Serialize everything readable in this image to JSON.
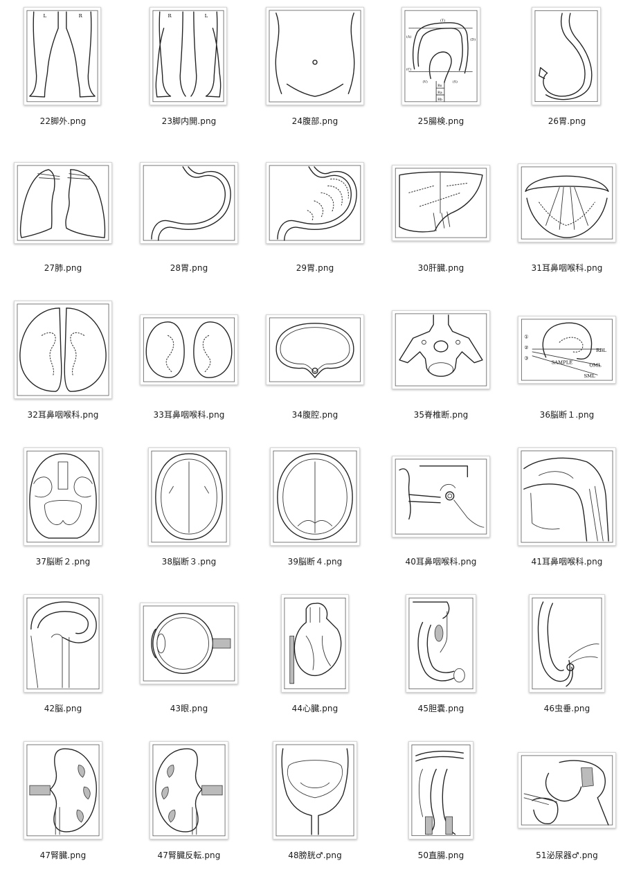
{
  "files": [
    {
      "name": "22脚外.png",
      "icon": "legs-front-icon",
      "art": "legs",
      "labels": [
        "L",
        "R"
      ]
    },
    {
      "name": "23脚内開.png",
      "icon": "legs-inner-icon",
      "art": "legs",
      "labels": [
        "R",
        "L"
      ]
    },
    {
      "name": "24腹部.png",
      "icon": "abdomen-icon",
      "art": "abdomen"
    },
    {
      "name": "25腸検.png",
      "icon": "colon-exam-icon",
      "art": "colon",
      "labels": [
        "(T)",
        "(A)",
        "(D)",
        "(C)",
        "(V)",
        "(S)",
        "Rs",
        "Ra",
        "Rb"
      ]
    },
    {
      "name": "26胃.png",
      "icon": "stomach-icon",
      "art": "stomach-simple"
    },
    {
      "name": "27肺.png",
      "icon": "lungs-icon",
      "art": "lungs"
    },
    {
      "name": "28胃.png",
      "icon": "stomach-icon",
      "art": "stomach"
    },
    {
      "name": "29胃.png",
      "icon": "stomach-mucosa-icon",
      "art": "stomach-mucosa"
    },
    {
      "name": "30肝臓.png",
      "icon": "liver-icon",
      "art": "liver"
    },
    {
      "name": "31耳鼻咽喉科.png",
      "icon": "larynx-icon",
      "art": "larynx"
    },
    {
      "name": "32耳鼻咽喉科.png",
      "icon": "tonsils-icon",
      "art": "tonsils-large"
    },
    {
      "name": "33耳鼻咽喉科.png",
      "icon": "tonsils-icon",
      "art": "tonsils-small"
    },
    {
      "name": "34腹腔.png",
      "icon": "abdominal-cavity-icon",
      "art": "cavity"
    },
    {
      "name": "35脊椎断.png",
      "icon": "vertebra-icon",
      "art": "vertebra"
    },
    {
      "name": "36脳断１.png",
      "icon": "brain-section-icon",
      "art": "sample",
      "labels": [
        "①",
        "②",
        "③",
        "RBL",
        "OML",
        "SAMPLE",
        "SML"
      ]
    },
    {
      "name": "37脳断２.png",
      "icon": "brain-section-icon",
      "art": "brain2"
    },
    {
      "name": "38脳断３.png",
      "icon": "brain-section-icon",
      "art": "brain3"
    },
    {
      "name": "39脳断４.png",
      "icon": "brain-section-icon",
      "art": "brain4"
    },
    {
      "name": "40耳鼻咽喉科.png",
      "icon": "inner-ear-icon",
      "art": "ear"
    },
    {
      "name": "41耳鼻咽喉科.png",
      "icon": "head-sagittal-icon",
      "art": "headsag"
    },
    {
      "name": "42脳.png",
      "icon": "brain-sagittal-icon",
      "art": "brainsag"
    },
    {
      "name": "43眼.png",
      "icon": "eye-icon",
      "art": "eye"
    },
    {
      "name": "44心臓.png",
      "icon": "heart-icon",
      "art": "heart"
    },
    {
      "name": "45胆嚢.png",
      "icon": "gallbladder-icon",
      "art": "gallbladder"
    },
    {
      "name": "46虫垂.png",
      "icon": "appendix-icon",
      "art": "appendix"
    },
    {
      "name": "47腎臓.png",
      "icon": "kidney-icon",
      "art": "kidney"
    },
    {
      "name": "47腎臓反転.png",
      "icon": "kidney-icon",
      "art": "kidney-flip"
    },
    {
      "name": "48膀胱♂.png",
      "icon": "bladder-icon",
      "art": "bladder"
    },
    {
      "name": "50直腸.png",
      "icon": "rectum-icon",
      "art": "rectum"
    },
    {
      "name": "51泌尿器♂.png",
      "icon": "urinary-organs-icon",
      "art": "urinary"
    }
  ]
}
